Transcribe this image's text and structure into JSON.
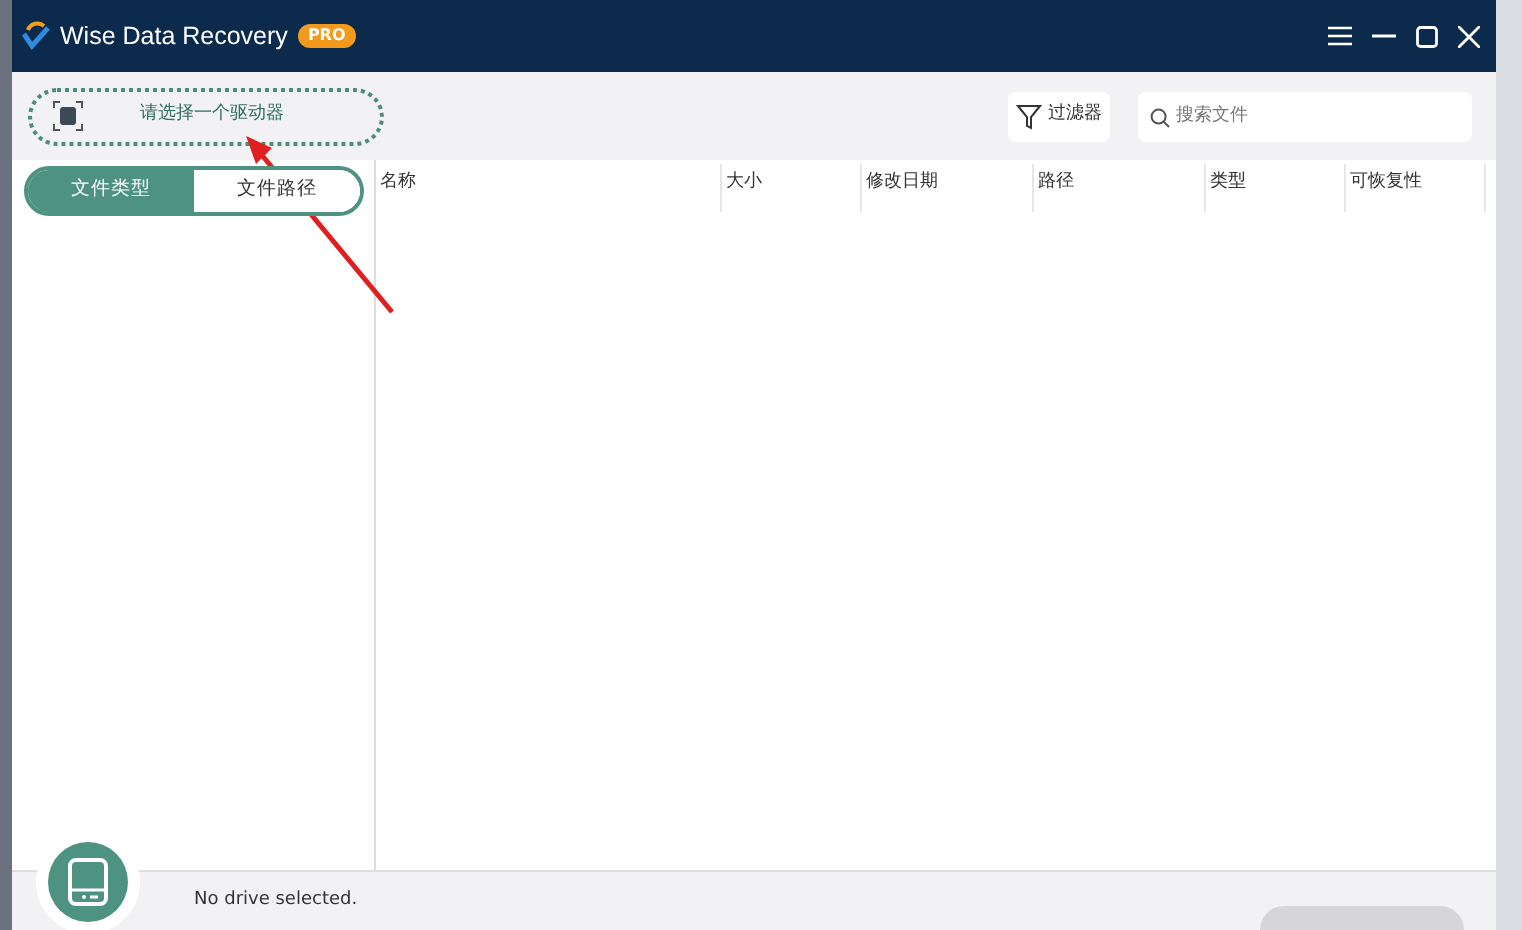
{
  "window": {
    "title": "Wise Data Recovery",
    "badge": "PRO"
  },
  "toolbar": {
    "drive_select": {
      "label": "请选择一个驱动器"
    },
    "filter_button": {
      "label": "过滤器"
    },
    "search": {
      "placeholder": "搜索文件"
    }
  },
  "view_tabs": [
    {
      "label": "文件类型",
      "selected": true
    },
    {
      "label": "文件路径",
      "selected": false
    }
  ],
  "table": {
    "columns": [
      "名称",
      "大小",
      "修改日期",
      "路径",
      "类型",
      "可恢复性"
    ]
  },
  "status_bar": {
    "message": "No drive selected."
  }
}
